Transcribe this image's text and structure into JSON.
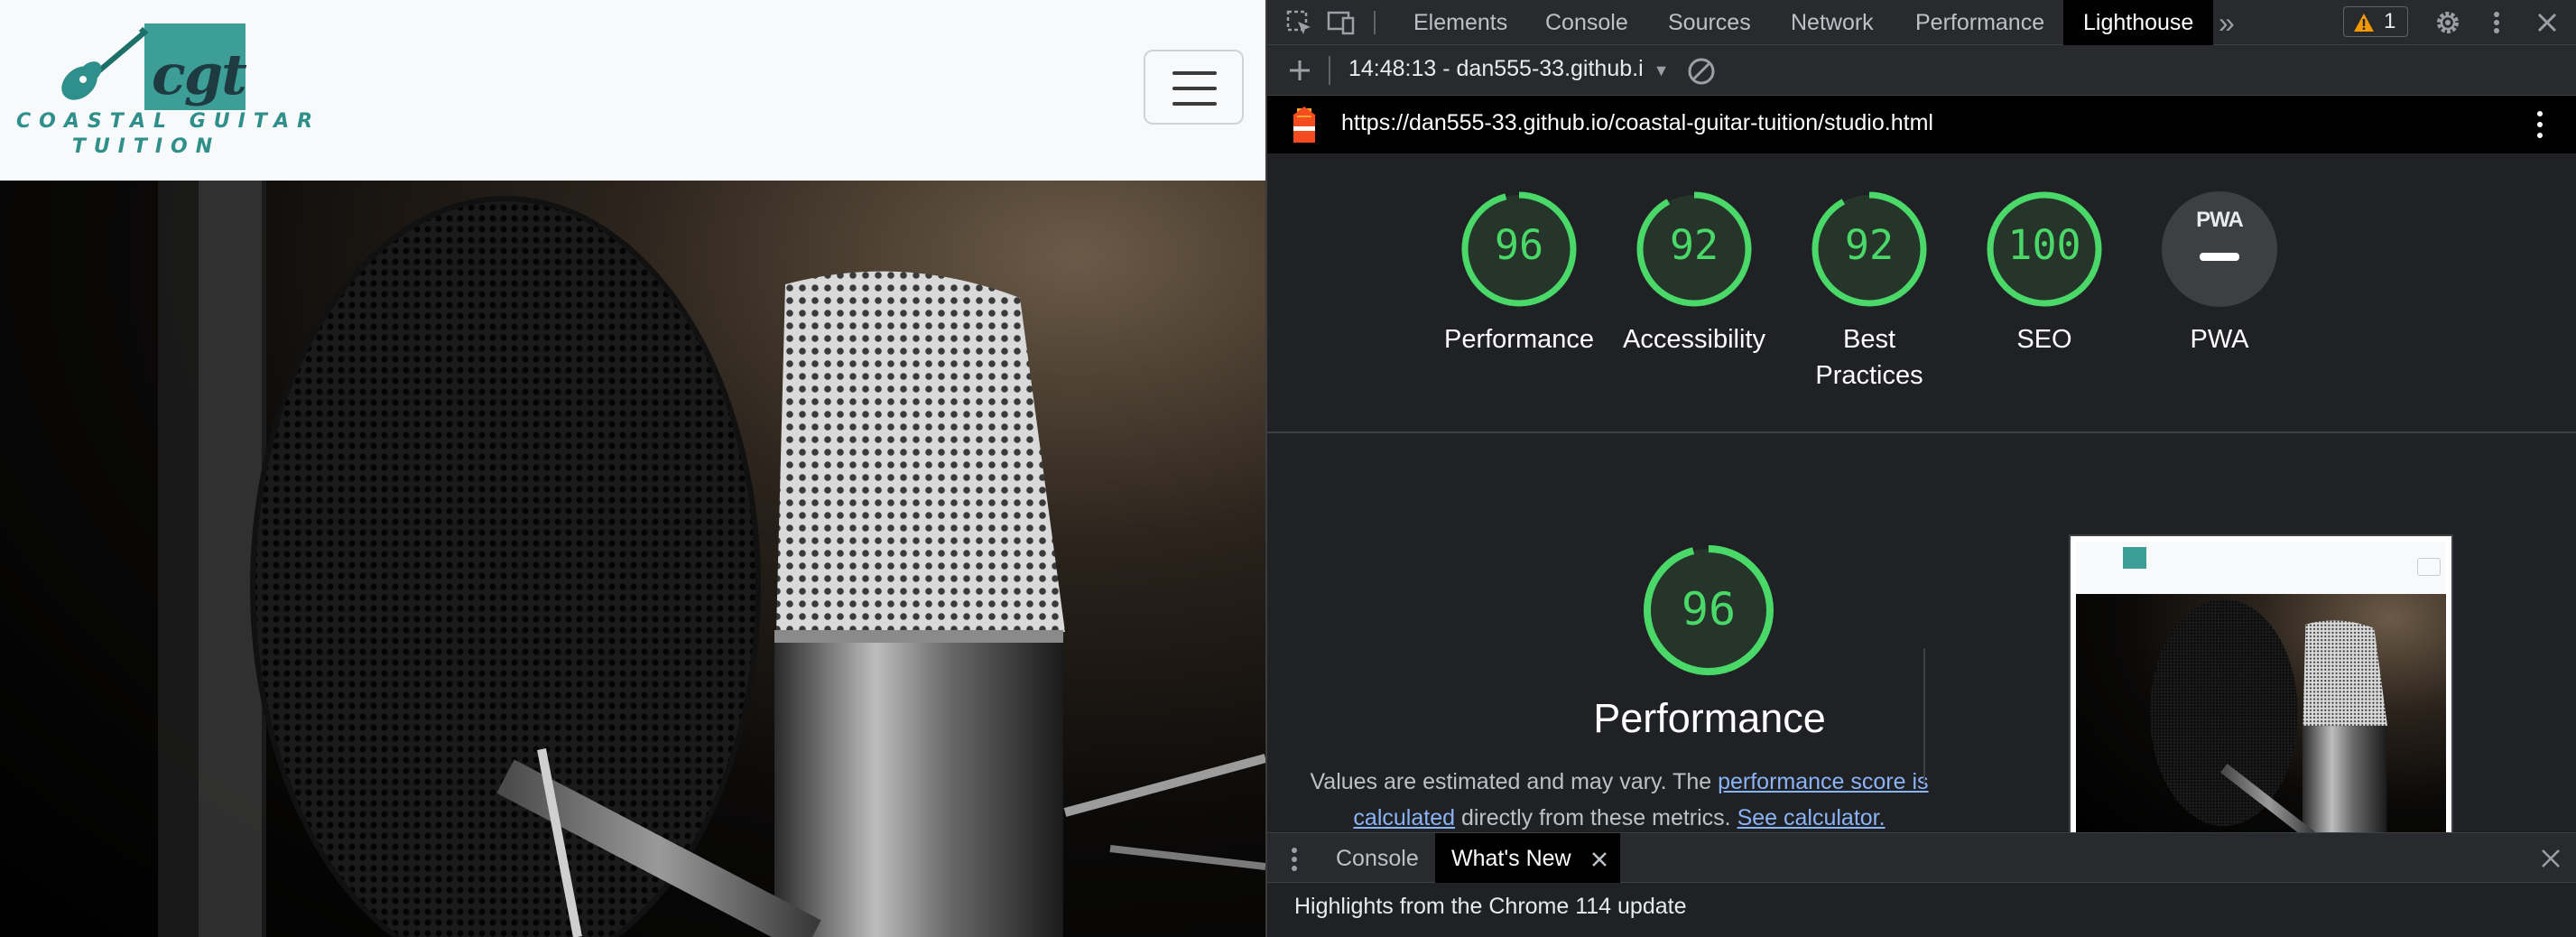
{
  "site": {
    "logo": {
      "monogram": "cgt",
      "name_line1": "COASTAL GUITAR",
      "name_line2": "TUITION"
    }
  },
  "devtools": {
    "panel_tabs": [
      "Elements",
      "Console",
      "Sources",
      "Network",
      "Performance",
      "Lighthouse"
    ],
    "active_tab": "Lighthouse",
    "more_tabs": "»",
    "warning_count": "1",
    "report_select": "14:48:13 - dan555-33.github.i",
    "report_url": "https://dan555-33.github.io/coastal-guitar-tuition/studio.html",
    "scores": [
      {
        "label": "Performance",
        "value": "96"
      },
      {
        "label": "Accessibility",
        "value": "92"
      },
      {
        "label": "Best Practices",
        "value": "92"
      },
      {
        "label": "SEO",
        "value": "100"
      }
    ],
    "pwa": {
      "label": "PWA",
      "badge": "PWA"
    },
    "performance_section": {
      "score": "96",
      "title": "Performance",
      "desc_pre": "Values are estimated and may vary. The ",
      "desc_link1": "performance score is calculated",
      "desc_mid": " directly from these metrics. ",
      "desc_link2": "See calculator."
    },
    "drawer": {
      "tabs": [
        "Console",
        "What's New"
      ],
      "active": "What's New",
      "body": "Highlights from the Chrome 114 update"
    },
    "colors": {
      "pass": "#4ad869",
      "gauge_fill": "#25352a"
    },
    "icons": [
      "inspect-icon",
      "device-toggle-icon",
      "warning-icon",
      "settings-icon",
      "kebab-menu-icon",
      "close-icon",
      "add-icon",
      "clear-icon",
      "lighthouse-icon",
      "drawer-menu-icon"
    ]
  }
}
